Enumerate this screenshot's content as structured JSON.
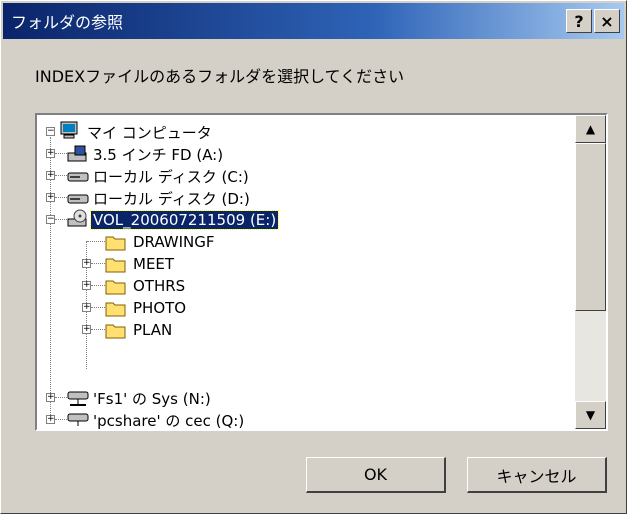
{
  "window": {
    "title": "フォルダの参照",
    "help_label": "?",
    "close_label": "×"
  },
  "prompt": "INDEXファイルのあるフォルダを選択してください",
  "tree": {
    "items": [
      {
        "label": "マイ コンピュータ",
        "icon": "computer-icon",
        "expander": "−"
      },
      {
        "label": "3.5 インチ FD (A:)",
        "icon": "floppy-drive-icon",
        "expander": "+"
      },
      {
        "label": "ローカル ディスク (C:)",
        "icon": "hard-drive-icon",
        "expander": "+"
      },
      {
        "label": "ローカル ディスク (D:)",
        "icon": "hard-drive-icon",
        "expander": "+"
      },
      {
        "label": "VOL_200607211509 (E:)",
        "icon": "cd-drive-icon",
        "expander": "−",
        "selected": true
      },
      {
        "label": "DRAWINGF",
        "icon": "folder-icon",
        "expander": ""
      },
      {
        "label": "MEET",
        "icon": "folder-icon",
        "expander": "+"
      },
      {
        "label": "OTHRS",
        "icon": "folder-icon",
        "expander": "+"
      },
      {
        "label": "PHOTO",
        "icon": "folder-icon",
        "expander": "+"
      },
      {
        "label": "PLAN",
        "icon": "folder-icon",
        "expander": "+"
      },
      {
        "label": "'Fs1' の Sys (N:)",
        "icon": "network-drive-icon",
        "expander": "+"
      },
      {
        "label": "'pcshare' の cec (Q:)",
        "icon": "network-drive-icon",
        "expander": "+"
      }
    ],
    "scroll_up": "▲",
    "scroll_down": "▼"
  },
  "buttons": {
    "ok_label": "OK",
    "cancel_label": "キャンセル"
  },
  "colors": {
    "selection": "#0a246a",
    "title_start": "#0a246a",
    "title_end": "#a6caf0",
    "face": "#d4d0c8"
  }
}
